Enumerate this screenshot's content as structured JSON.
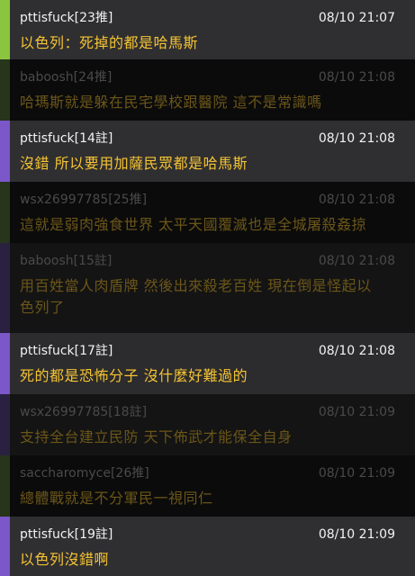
{
  "colors": {
    "bright_bg_1": "#2f2f31",
    "bright_bg_2": "#2c2c2e",
    "dim_bg_1": "#141414",
    "dim_bg_2": "#0b0b0b",
    "bright_meta": "#f2f2f2",
    "bright_text": "#f5c332",
    "dim_meta": "#4a4a4a",
    "dim_text": "#6b5619",
    "bar_green": "#8bc53f",
    "bar_purple": "#7b57c9",
    "bar_dark_green": "#27351a",
    "bar_dark_purple": "#2a2140"
  },
  "comments": [
    {
      "user": "pttisfuck",
      "tag": "[23推]",
      "time": "08/10 21:07",
      "lines": [
        "以色列：死掉的都是哈馬斯"
      ],
      "state": "bright",
      "bar": "green"
    },
    {
      "user": "baboosh",
      "tag": "[24推]",
      "time": "08/10 21:08",
      "lines": [
        "哈瑪斯就是躲在民宅學校跟醫院 這不是常識嗎"
      ],
      "state": "dim",
      "bar": "dark_green"
    },
    {
      "user": "pttisfuck",
      "tag": "[14註]",
      "time": "08/10 21:08",
      "lines": [
        "沒錯 所以要用加薩民眾都是哈馬斯"
      ],
      "state": "bright",
      "bar": "purple"
    },
    {
      "user": "wsx26997785",
      "tag": "[25推]",
      "time": "08/10 21:08",
      "lines": [
        "這就是弱肉強食世界  太平天國覆滅也是全城屠殺姦掠"
      ],
      "state": "dim",
      "bar": "dark_green"
    },
    {
      "user": "baboosh",
      "tag": "[15註]",
      "time": "08/10 21:08",
      "lines": [
        "用百姓當人肉盾牌 然後出來殺老百姓 現在倒是怪起以",
        "色列了"
      ],
      "state": "dim",
      "bar": "dark_purple"
    },
    {
      "user": "pttisfuck",
      "tag": "[17註]",
      "time": "08/10 21:08",
      "lines": [
        "死的都是恐怖分子 沒什麼好難過的"
      ],
      "state": "bright",
      "bar": "purple"
    },
    {
      "user": "wsx26997785",
      "tag": "[18註]",
      "time": "08/10 21:09",
      "lines": [
        "支持全台建立民防  天下佈武才能保全自身"
      ],
      "state": "dim",
      "bar": "dark_purple"
    },
    {
      "user": "saccharomyce",
      "tag": "[26推]",
      "time": "08/10 21:09",
      "lines": [
        "總體戰就是不分軍民一視同仁"
      ],
      "state": "dim",
      "bar": "dark_green"
    },
    {
      "user": "pttisfuck",
      "tag": "[19註]",
      "time": "08/10 21:09",
      "lines": [
        "以色列沒錯啊"
      ],
      "state": "bright",
      "bar": "purple"
    }
  ]
}
